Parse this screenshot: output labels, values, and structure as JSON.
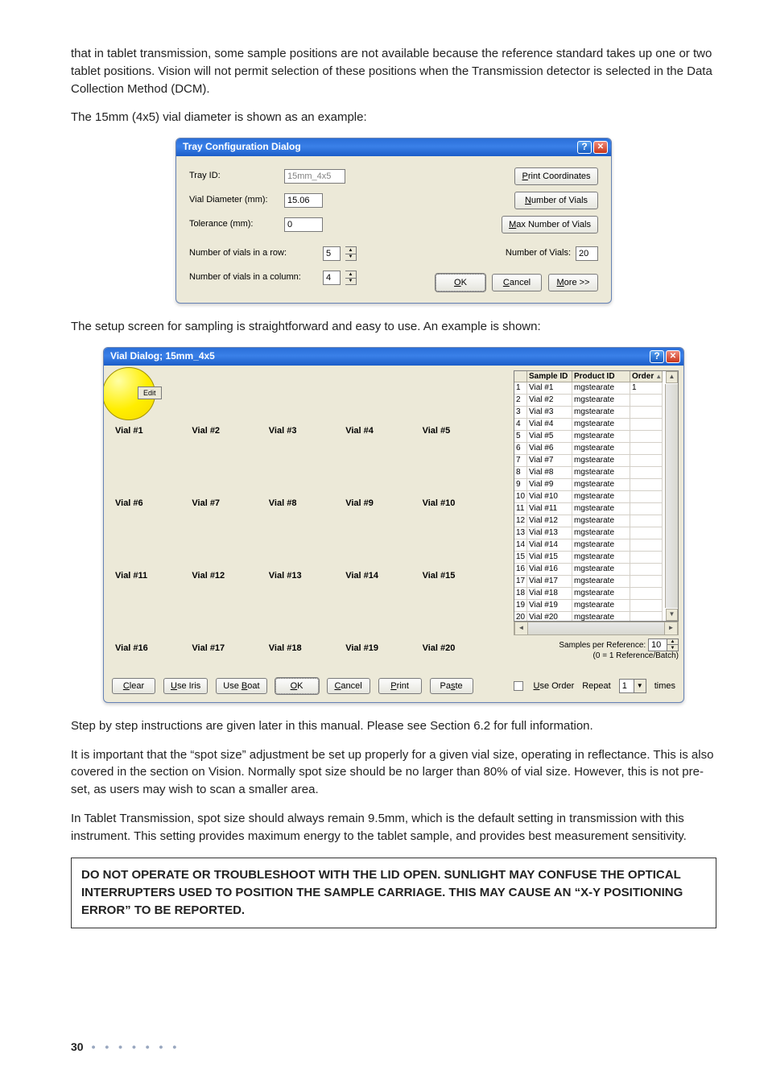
{
  "para1": "that in tablet transmission, some sample positions are not available because the reference standard takes up one or two tablet positions. Vision will not permit selection of these positions when the Transmission detector is selected in the Data Collection Method (DCM).",
  "para2": "The 15mm (4x5) vial diameter is shown as an example:",
  "trayDialog": {
    "title": "Tray Configuration Dialog",
    "trayIdLabel": "Tray ID:",
    "trayId": "15mm_4x5",
    "vialDiameterLabel": "Vial Diameter (mm):",
    "vialDiameter": "15.06",
    "toleranceLabel": "Tolerance (mm):",
    "tolerance": "0",
    "rowCountLabel": "Number of vials in a row:",
    "rowCount": "5",
    "colCountLabel": "Number of vials in a column:",
    "colCount": "4",
    "printBtn": "Print Coordinates",
    "numVialsBtn": "Number of Vials",
    "maxNumVialsBtn": "Max Number of Vials",
    "numVialsLabel": "Number of Vials:",
    "numVials": "20",
    "ok": "OK",
    "cancel": "Cancel",
    "more": "More >>"
  },
  "para3": "The setup screen for sampling is straightforward and easy to use. An example is shown:",
  "vialDialog": {
    "title": "Vial Dialog; 15mm_4x5",
    "editLabel": "Edit",
    "vials": [
      "Vial #1",
      "Vial #2",
      "Vial #3",
      "Vial #4",
      "Vial #5",
      "Vial #6",
      "Vial #7",
      "Vial #8",
      "Vial #9",
      "Vial #10",
      "Vial #11",
      "Vial #12",
      "Vial #13",
      "Vial #14",
      "Vial #15",
      "Vial #16",
      "Vial #17",
      "Vial #18",
      "Vial #19",
      "Vial #20"
    ],
    "columns": [
      "",
      "Sample ID",
      "Product ID",
      "Order"
    ],
    "rows": [
      {
        "n": "1",
        "sample": "Vial #1",
        "product": "mgstearate",
        "order": "1"
      },
      {
        "n": "2",
        "sample": "Vial #2",
        "product": "mgstearate",
        "order": ""
      },
      {
        "n": "3",
        "sample": "Vial #3",
        "product": "mgstearate",
        "order": ""
      },
      {
        "n": "4",
        "sample": "Vial #4",
        "product": "mgstearate",
        "order": ""
      },
      {
        "n": "5",
        "sample": "Vial #5",
        "product": "mgstearate",
        "order": ""
      },
      {
        "n": "6",
        "sample": "Vial #6",
        "product": "mgstearate",
        "order": ""
      },
      {
        "n": "7",
        "sample": "Vial #7",
        "product": "mgstearate",
        "order": ""
      },
      {
        "n": "8",
        "sample": "Vial #8",
        "product": "mgstearate",
        "order": ""
      },
      {
        "n": "9",
        "sample": "Vial #9",
        "product": "mgstearate",
        "order": ""
      },
      {
        "n": "10",
        "sample": "Vial #10",
        "product": "mgstearate",
        "order": ""
      },
      {
        "n": "11",
        "sample": "Vial #11",
        "product": "mgstearate",
        "order": ""
      },
      {
        "n": "12",
        "sample": "Vial #12",
        "product": "mgstearate",
        "order": ""
      },
      {
        "n": "13",
        "sample": "Vial #13",
        "product": "mgstearate",
        "order": ""
      },
      {
        "n": "14",
        "sample": "Vial #14",
        "product": "mgstearate",
        "order": ""
      },
      {
        "n": "15",
        "sample": "Vial #15",
        "product": "mgstearate",
        "order": ""
      },
      {
        "n": "16",
        "sample": "Vial #16",
        "product": "mgstearate",
        "order": ""
      },
      {
        "n": "17",
        "sample": "Vial #17",
        "product": "mgstearate",
        "order": ""
      },
      {
        "n": "18",
        "sample": "Vial #18",
        "product": "mgstearate",
        "order": ""
      },
      {
        "n": "19",
        "sample": "Vial #19",
        "product": "mgstearate",
        "order": ""
      },
      {
        "n": "20",
        "sample": "Vial #20",
        "product": "mgstearate",
        "order": ""
      }
    ],
    "sprLabel1": "Samples per Reference:",
    "sprLabel2": "(0 = 1 Reference/Batch)",
    "sprValue": "10",
    "footer": {
      "clear": "Clear",
      "useIris": "Use Iris",
      "useBoat": "Use Boat",
      "ok": "OK",
      "cancel": "Cancel",
      "print": "Print",
      "paste": "Paste",
      "useOrder": "Use Order",
      "repeat": "Repeat",
      "repeatValue": "1",
      "times": "times"
    }
  },
  "para4": "Step by step instructions are given later in this manual. Please see Section 6.2 for full information.",
  "para5": "It is important that the “spot size” adjustment be set up properly for a given vial size, operating in reflectance. This is also covered in the section on Vision. Normally spot size should be no larger than 80% of vial size. However, this is not pre-set, as users may wish to scan a smaller area.",
  "para6": "In Tablet Transmission, spot size should always remain 9.5mm, which is the default setting in transmission with this instrument. This setting provides maximum energy to the tablet sample, and provides best measurement sensitivity.",
  "callout": "DO NOT OPERATE OR TROUBLESHOOT WITH THE LID OPEN. SUNLIGHT MAY CONFUSE THE OPTICAL INTERRUPTERS USED TO POSITION THE SAMPLE CARRIAGE. THIS MAY CAUSE AN “X-Y POSITIONING ERROR” TO BE REPORTED.",
  "pageNumber": "30"
}
